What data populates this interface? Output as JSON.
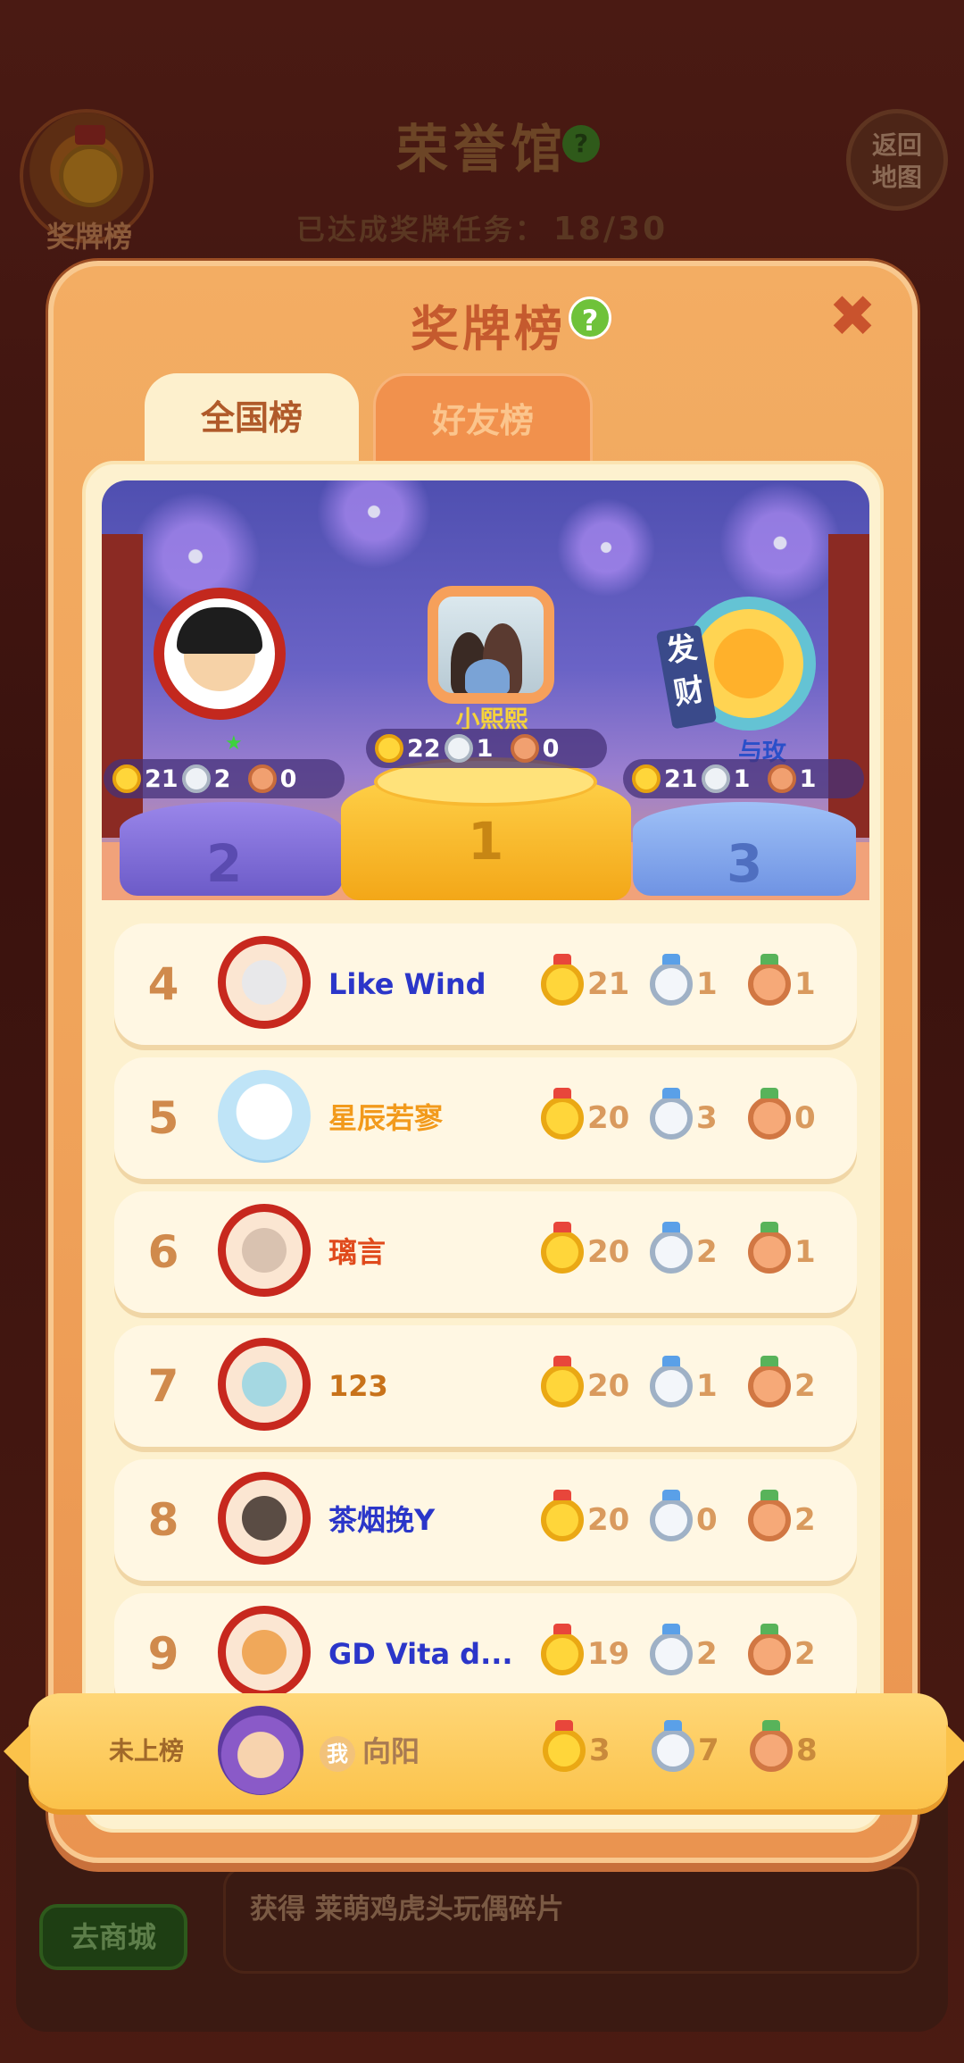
{
  "background": {
    "badge_label": "奖牌榜",
    "title": "荣誉馆",
    "help_glyph": "?",
    "back_label": "返回\n地图",
    "progress_label": "已达成奖牌任务：",
    "progress_value": "18/30",
    "reward_text": "获得 莱萌鸡虎头玩偶碎片",
    "shop_label": "去商城"
  },
  "modal": {
    "title": "奖牌榜",
    "help_glyph": "?",
    "close_glyph": "✖",
    "tabs": [
      {
        "label": "全国榜",
        "active": true
      },
      {
        "label": "好友榜",
        "active": false
      }
    ]
  },
  "podium": [
    {
      "rank": "1",
      "name": "小熙熙",
      "gold": "22",
      "silver": "1",
      "bronze": "0"
    },
    {
      "rank": "2",
      "name": "",
      "gold": "21",
      "silver": "2",
      "bronze": "0"
    },
    {
      "rank": "3",
      "name": "与玫",
      "gold": "21",
      "silver": "1",
      "bronze": "1",
      "frame_tag": "发财"
    }
  ],
  "rows": [
    {
      "rank": "4",
      "name": "Like  Wind",
      "name_color": "#2b36c9",
      "gold": "21",
      "silver": "1",
      "bronze": "1"
    },
    {
      "rank": "5",
      "name": "星辰若寥",
      "name_color": "#f29a1c",
      "gold": "20",
      "silver": "3",
      "bronze": "0"
    },
    {
      "rank": "6",
      "name": "璃言",
      "name_color": "#e04a1c",
      "gold": "20",
      "silver": "2",
      "bronze": "1"
    },
    {
      "rank": "7",
      "name": "123",
      "name_color": "#c8721a",
      "gold": "20",
      "silver": "1",
      "bronze": "2"
    },
    {
      "rank": "8",
      "name": "茶烟挽Y",
      "name_color": "#2b36c9",
      "gold": "20",
      "silver": "0",
      "bronze": "2"
    },
    {
      "rank": "9",
      "name": "GD Vita d...",
      "name_color": "#2b36c9",
      "gold": "19",
      "silver": "2",
      "bronze": "2"
    }
  ],
  "me": {
    "status": "未上榜",
    "tag": "我",
    "name": "向阳",
    "gold": "3",
    "silver": "7",
    "bronze": "8"
  },
  "colors": {
    "modal_bg": "#f0a35a",
    "panel_bg": "#fdf1cf",
    "gold": "#ffd63a",
    "silver": "#f3f6fa",
    "bronze": "#f6a978",
    "accent_red": "#c55a2e"
  },
  "icons": [
    "help-icon",
    "close-icon",
    "gold-medal-icon",
    "silver-medal-icon",
    "bronze-medal-icon",
    "star-icon"
  ]
}
